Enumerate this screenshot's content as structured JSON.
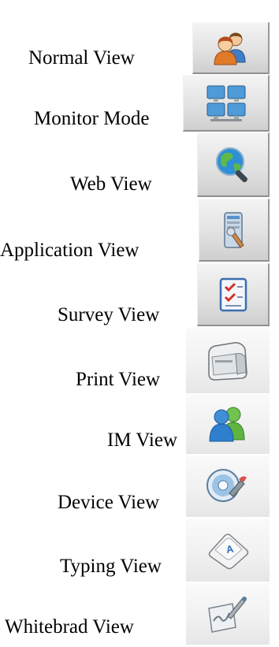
{
  "views": [
    {
      "label": "Normal View",
      "icon": "users-icon"
    },
    {
      "label": "Monitor Mode",
      "icon": "monitors-icon"
    },
    {
      "label": "Web View",
      "icon": "globe-magnifier-icon"
    },
    {
      "label": "Application View",
      "icon": "application-icon"
    },
    {
      "label": "Survey View",
      "icon": "checklist-icon"
    },
    {
      "label": "Print View",
      "icon": "printer-icon"
    },
    {
      "label": "IM View",
      "icon": "messenger-icon"
    },
    {
      "label": "Device View",
      "icon": "disc-device-icon"
    },
    {
      "label": "Typing View",
      "icon": "keyboard-key-icon"
    },
    {
      "label": "Whitebrad View",
      "icon": "whiteboard-pen-icon"
    }
  ],
  "colors": {
    "button_face": "#e2e2e2",
    "button_shadow": "#8f8f8f"
  }
}
